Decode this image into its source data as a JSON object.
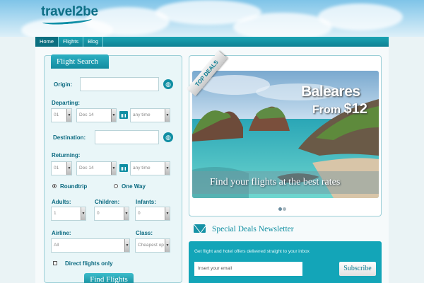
{
  "header": {
    "logo_text": "travel2be"
  },
  "nav": {
    "items": [
      "Home",
      "Flights",
      "Blog"
    ],
    "active": "Home"
  },
  "search": {
    "tab_label": "Flight Search",
    "origin_label": "Origin:",
    "departing_label": "Departing:",
    "departing_day": "01",
    "departing_month": "Dec 14",
    "departing_time": "any time",
    "destination_label": "Destination:",
    "returning_label": "Returning:",
    "returning_day": "01",
    "returning_month": "Dec 14",
    "returning_time": "any time",
    "trip_roundtrip": "Roundtrip",
    "trip_oneway": "One Way",
    "adults_label": "Adults:",
    "adults_value": "1",
    "children_label": "Children:",
    "children_value": "0",
    "infants_label": "Infants:",
    "infants_value": "0",
    "airline_label": "Airline:",
    "airline_value": "All",
    "class_label": "Class:",
    "class_value": "Cheapest op",
    "direct_label": "Direct flights only",
    "find_button": "Find Flights"
  },
  "deals": {
    "ribbon": "TOP DEALS",
    "hero_title": "Baleares",
    "hero_price_prefix": "From",
    "hero_price": "$12",
    "hero_caption": "Find your flights at the best rates",
    "slide_count": 2,
    "active_slide": 1
  },
  "newsletter": {
    "title": "Special Deals Newsletter",
    "text": "Get flight and hotel offers delivered straight to your inbox",
    "email_placeholder": "Insert your email",
    "subscribe_button": "Subscribe"
  },
  "colors": {
    "brand": "#0f8ea3",
    "accent": "#13a5b8",
    "nav_active": "#0b6f80"
  }
}
